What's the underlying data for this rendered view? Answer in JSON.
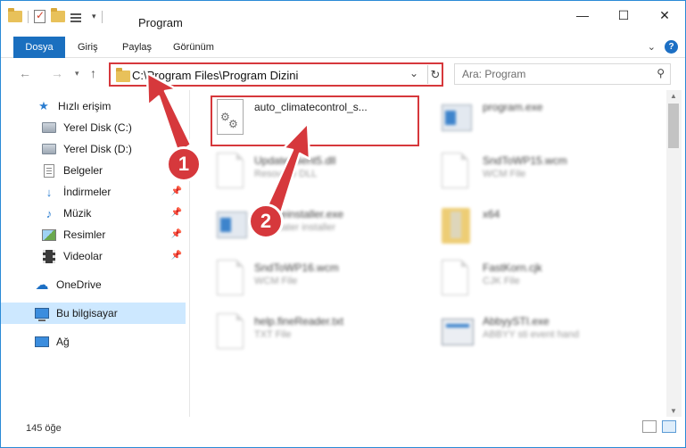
{
  "window": {
    "title": "Program",
    "controls": {
      "minimize": "—",
      "maximize": "☐",
      "close": "✕"
    }
  },
  "ribbon": {
    "tabs": [
      "Dosya",
      "Giriş",
      "Paylaş",
      "Görünüm"
    ]
  },
  "address": {
    "path": "C:\\Program Files\\Program Dizini"
  },
  "search": {
    "placeholder": "Ara: Program"
  },
  "sidebar": {
    "items": [
      {
        "label": "Hızlı erişim",
        "icon": "star-icon"
      },
      {
        "label": "Yerel Disk (C:)",
        "icon": "drive-icon"
      },
      {
        "label": "Yerel Disk (D:)",
        "icon": "drive-icon"
      },
      {
        "label": "Belgeler",
        "icon": "documents-icon"
      },
      {
        "label": "İndirmeler",
        "icon": "download-icon"
      },
      {
        "label": "Müzik",
        "icon": "music-icon"
      },
      {
        "label": "Resimler",
        "icon": "pictures-icon"
      },
      {
        "label": "Videolar",
        "icon": "videos-icon"
      },
      {
        "label": "OneDrive",
        "icon": "cloud-icon"
      },
      {
        "label": "Bu bilgisayar",
        "icon": "computer-icon"
      },
      {
        "label": "Ağ",
        "icon": "network-icon"
      }
    ]
  },
  "files": [
    {
      "name": "auto_climatecontrol_s...",
      "type": ""
    },
    {
      "name": "program.exe",
      "type": ""
    },
    {
      "name": "UpdateClient5.dll",
      "type": "Resource DLL"
    },
    {
      "name": "SndToWP15.wcm",
      "type": "WCM File"
    },
    {
      "name": "updateinstaller.exe",
      "type": "Pl updater installer"
    },
    {
      "name": "x64",
      "type": ""
    },
    {
      "name": "SndToWP16.wcm",
      "type": "WCM File"
    },
    {
      "name": "FastKorn.cjk",
      "type": "CJK File"
    },
    {
      "name": "help.fineReader.txt",
      "type": "TXT File"
    },
    {
      "name": "AbbyySTI.exe",
      "type": "ABBYY sti event hand"
    }
  ],
  "annotations": {
    "step1": "1",
    "step2": "2"
  },
  "status": {
    "count": "145 öğe"
  },
  "colors": {
    "accent": "#1a6fbf",
    "highlight": "#d6383c",
    "selected": "#cde8ff"
  }
}
